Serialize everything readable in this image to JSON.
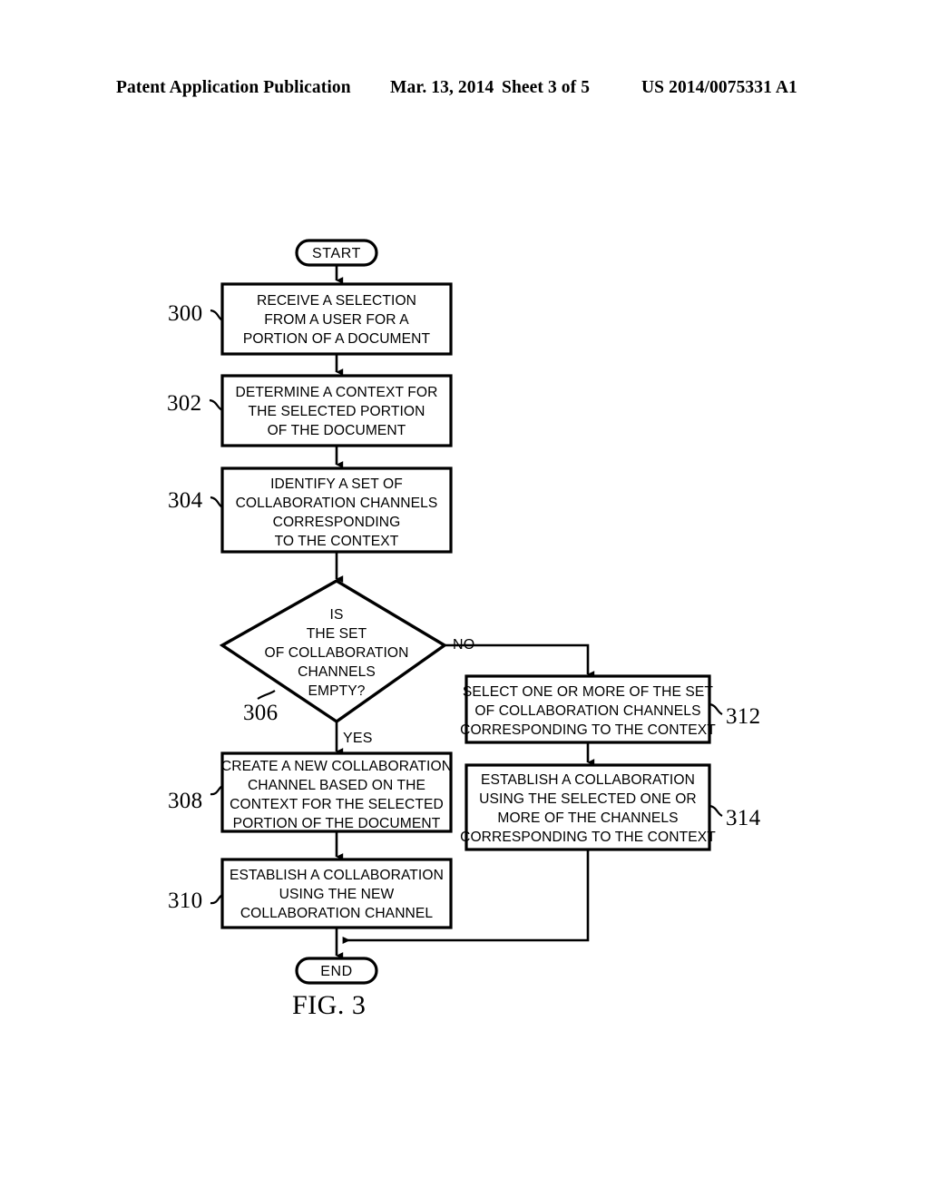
{
  "header": {
    "publication": "Patent Application Publication",
    "date": "Mar. 13, 2014",
    "sheet": "Sheet 3 of 5",
    "patent_number": "US 2014/0075331 A1"
  },
  "figure": {
    "caption": "FIG. 3"
  },
  "flowchart": {
    "start": {
      "label": "START"
    },
    "end": {
      "label": "END"
    },
    "branch_labels": {
      "no": "NO",
      "yes": "YES"
    },
    "nodes": [
      {
        "ref": "300",
        "type": "process",
        "lines": [
          "RECEIVE A SELECTION",
          "FROM A USER FOR A",
          "PORTION OF A DOCUMENT"
        ]
      },
      {
        "ref": "302",
        "type": "process",
        "lines": [
          "DETERMINE A CONTEXT FOR",
          "THE SELECTED PORTION",
          "OF THE DOCUMENT"
        ]
      },
      {
        "ref": "304",
        "type": "process",
        "lines": [
          "IDENTIFY A SET OF",
          "COLLABORATION CHANNELS",
          "CORRESPONDING",
          "TO THE CONTEXT"
        ]
      },
      {
        "ref": "306",
        "type": "decision",
        "lines": [
          "IS",
          "THE SET",
          "OF COLLABORATION",
          "CHANNELS",
          "EMPTY?"
        ]
      },
      {
        "ref": "308",
        "type": "process",
        "lines": [
          "CREATE A NEW COLLABORATION",
          "CHANNEL BASED ON THE",
          "CONTEXT FOR THE SELECTED",
          "PORTION OF THE DOCUMENT"
        ]
      },
      {
        "ref": "310",
        "type": "process",
        "lines": [
          "ESTABLISH A COLLABORATION",
          "USING THE NEW",
          "COLLABORATION CHANNEL"
        ]
      },
      {
        "ref": "312",
        "type": "process",
        "lines": [
          "SELECT ONE OR MORE OF THE SET",
          "OF COLLABORATION CHANNELS",
          "CORRESPONDING TO THE CONTEXT"
        ]
      },
      {
        "ref": "314",
        "type": "process",
        "lines": [
          "ESTABLISH A COLLABORATION",
          "USING THE SELECTED ONE OR",
          "MORE OF THE CHANNELS",
          "CORRESPONDING TO THE CONTEXT"
        ]
      }
    ]
  },
  "colors": {
    "ink": "#000000",
    "paper": "#ffffff"
  }
}
